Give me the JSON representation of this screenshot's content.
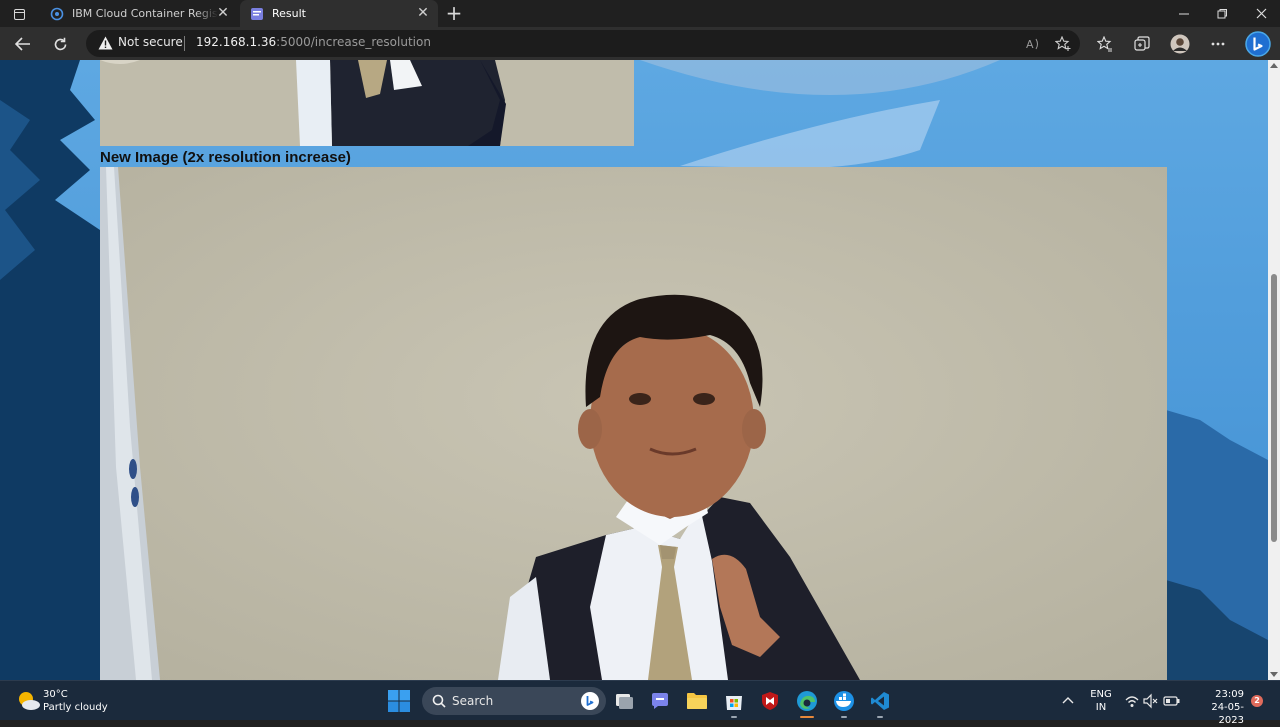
{
  "browser": {
    "tabs": [
      {
        "title": "IBM Cloud Container Registry - IBM",
        "active": false
      },
      {
        "title": "Result",
        "active": true
      }
    ],
    "security_label": "Not secure",
    "url_host": "192.168.1.36",
    "url_rest": ":5000/increase_resolution"
  },
  "page": {
    "caption": "New Image (2x resolution increase)"
  },
  "taskbar": {
    "weather": {
      "temp": "30°C",
      "condition": "Partly cloudy"
    },
    "search_label": "Search",
    "language": {
      "line1": "ENG",
      "line2": "IN"
    },
    "clock": {
      "time": "23:09",
      "date": "24-05-2023"
    },
    "notification_count": "2"
  },
  "colors": {
    "accent": "#4aa8e8",
    "page_background": "#5aa5de"
  }
}
